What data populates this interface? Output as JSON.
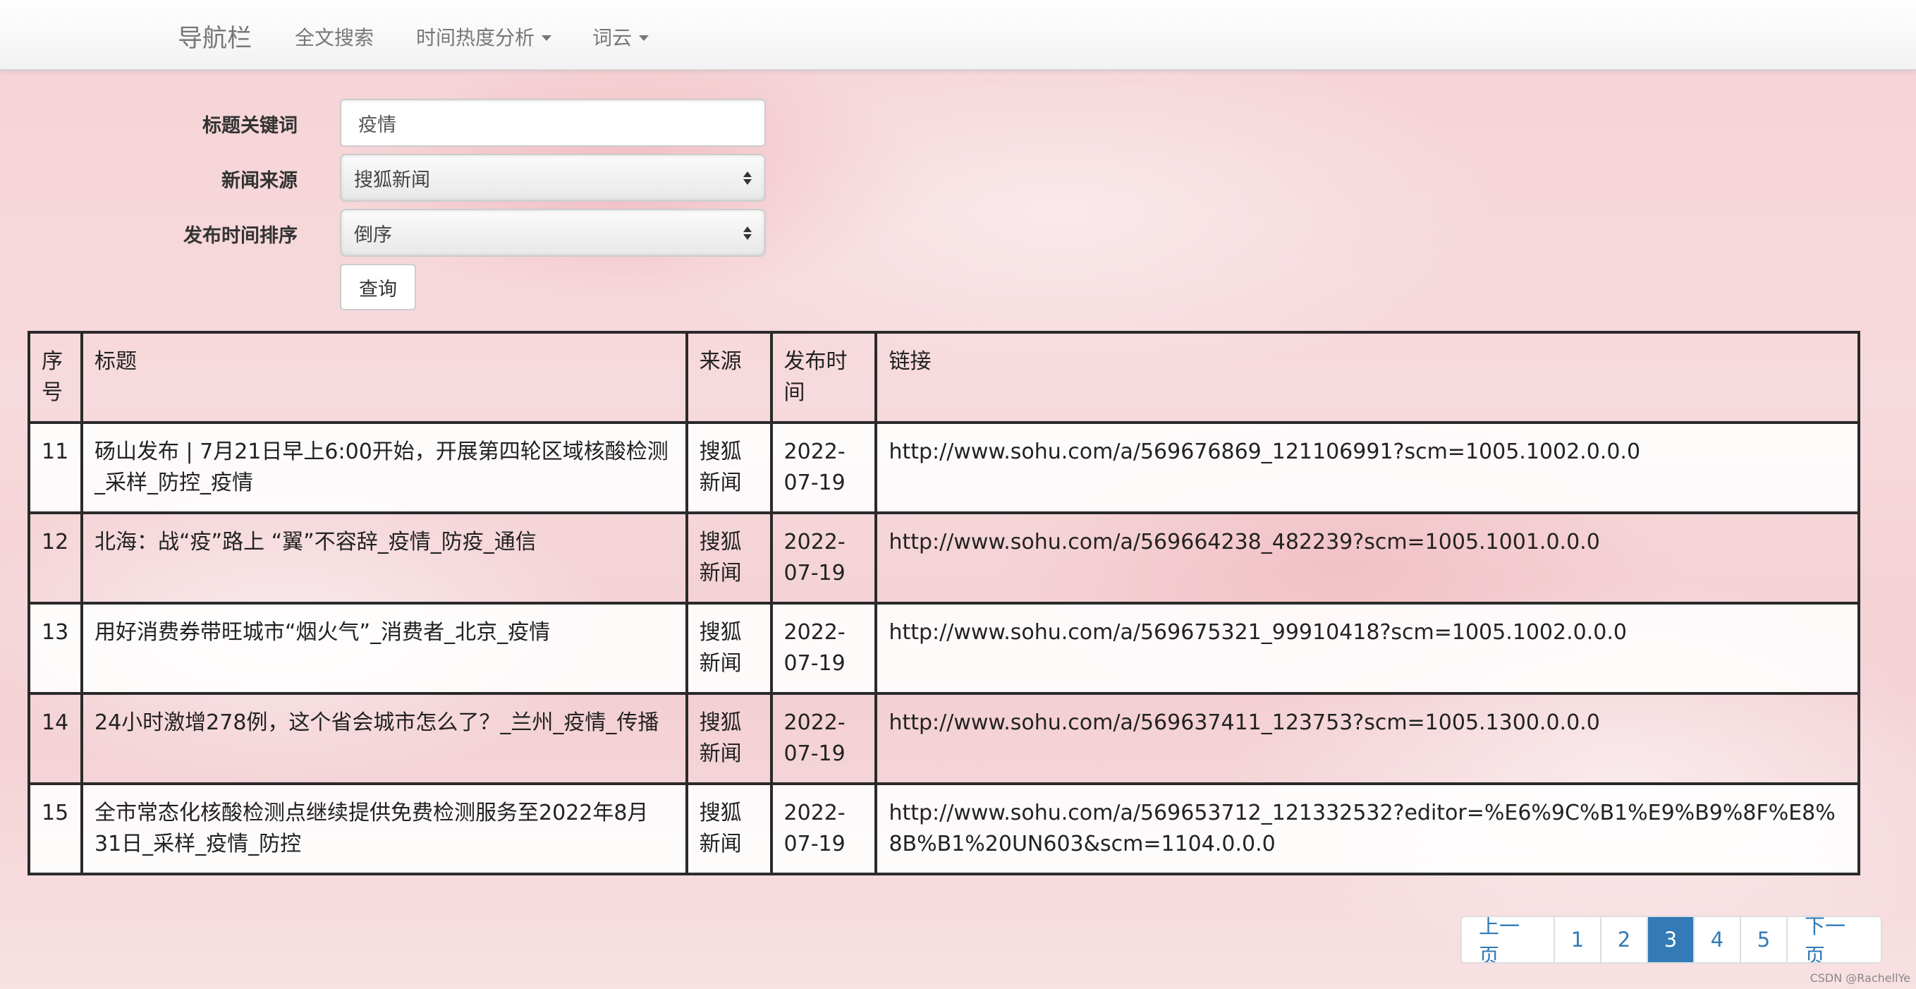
{
  "navbar": {
    "brand": "导航栏",
    "items": [
      {
        "label": "全文搜索",
        "dropdown": false
      },
      {
        "label": "时间热度分析",
        "dropdown": true
      },
      {
        "label": "词云",
        "dropdown": true
      }
    ]
  },
  "form": {
    "keyword_label": "标题关键词",
    "keyword_value": "疫情",
    "source_label": "新闻来源",
    "source_value": "搜狐新闻",
    "sort_label": "发布时间排序",
    "sort_value": "倒序",
    "query_button": "查询"
  },
  "table": {
    "headers": [
      "序号",
      "标题",
      "来源",
      "发布时间",
      "链接"
    ],
    "rows": [
      {
        "id": "11",
        "title": "砀山发布 | 7月21日早上6:00开始，开展第四轮区域核酸检测_采样_防控_疫情",
        "source": "搜狐新闻",
        "date": "2022-07-19",
        "link": "http://www.sohu.com/a/569676869_121106991?scm=1005.1002.0.0.0"
      },
      {
        "id": "12",
        "title": "北海：战“疫”路上 “翼”不容辞_疫情_防疫_通信",
        "source": "搜狐新闻",
        "date": "2022-07-19",
        "link": "http://www.sohu.com/a/569664238_482239?scm=1005.1001.0.0.0"
      },
      {
        "id": "13",
        "title": "用好消费券带旺城市“烟火气”_消费者_北京_疫情",
        "source": "搜狐新闻",
        "date": "2022-07-19",
        "link": "http://www.sohu.com/a/569675321_99910418?scm=1005.1002.0.0.0"
      },
      {
        "id": "14",
        "title": "24小时激增278例，这个省会城市怎么了？_兰州_疫情_传播",
        "source": "搜狐新闻",
        "date": "2022-07-19",
        "link": "http://www.sohu.com/a/569637411_123753?scm=1005.1300.0.0.0"
      },
      {
        "id": "15",
        "title": "全市常态化核酸检测点继续提供免费检测服务至2022年8月31日_采样_疫情_防控",
        "source": "搜狐新闻",
        "date": "2022-07-19",
        "link": "http://www.sohu.com/a/569653712_121332532?editor=%E6%9C%B1%E9%B9%8F%E8%8B%B1%20UN603&scm=1104.0.0.0"
      }
    ]
  },
  "pagination": {
    "prev": "上一页",
    "pages": [
      "1",
      "2",
      "3",
      "4",
      "5"
    ],
    "active": "3",
    "next": "下一页"
  },
  "watermark": "CSDN @RachellYe",
  "colors": {
    "accent": "#337ab7",
    "nav_text": "#777777"
  }
}
